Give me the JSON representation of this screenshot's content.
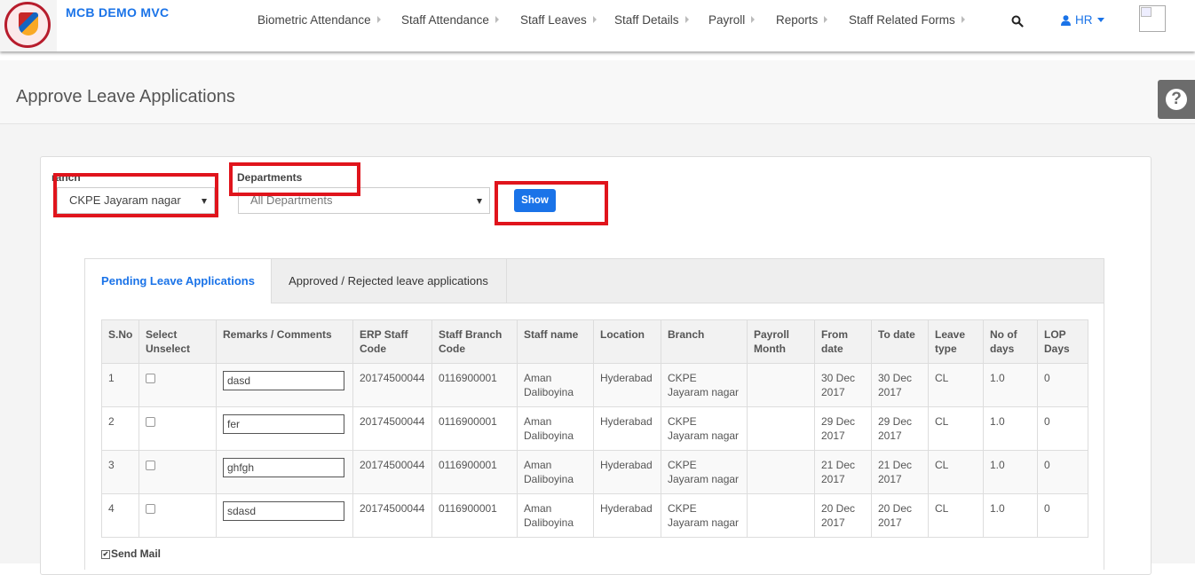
{
  "app": {
    "title": "MCB DEMO MVC"
  },
  "nav": {
    "items": [
      {
        "label": "Biometric Attendance"
      },
      {
        "label": "Staff Attendance"
      },
      {
        "label": "Staff Leaves"
      },
      {
        "label": "Staff Details"
      },
      {
        "label": "Payroll"
      },
      {
        "label": "Reports"
      },
      {
        "label": "Staff Related Forms"
      }
    ],
    "user": "HR"
  },
  "page": {
    "title": "Approve Leave Applications"
  },
  "filters": {
    "branch_label": "ranch",
    "branch_value": "CKPE Jayaram nagar",
    "dept_label": "Departments",
    "dept_value": "All Departments",
    "show_label": "Show"
  },
  "tabs": [
    {
      "label": "Pending Leave Applications",
      "active": true
    },
    {
      "label": "Approved / Rejected leave applications",
      "active": false
    }
  ],
  "table": {
    "headers": [
      "S.No",
      "Select Unselect",
      "Remarks / Comments",
      "ERP Staff Code",
      "Staff Branch Code",
      "Staff name",
      "Location",
      "Branch",
      "Payroll Month",
      "From date",
      "To date",
      "Leave type",
      "No of days",
      "LOP Days"
    ],
    "rows": [
      {
        "sno": "1",
        "remark": "dasd",
        "erp": "20174500044",
        "branch_code": "0116900001",
        "name": "Aman Daliboyina",
        "location": "Hyderabad",
        "branch": "CKPE Jayaram nagar",
        "payroll": "",
        "from": "30 Dec 2017",
        "to": "30 Dec 2017",
        "type": "CL",
        "days": "1.0",
        "lop": "0"
      },
      {
        "sno": "2",
        "remark": "fer",
        "erp": "20174500044",
        "branch_code": "0116900001",
        "name": "Aman Daliboyina",
        "location": "Hyderabad",
        "branch": "CKPE Jayaram nagar",
        "payroll": "",
        "from": "29 Dec 2017",
        "to": "29 Dec 2017",
        "type": "CL",
        "days": "1.0",
        "lop": "0"
      },
      {
        "sno": "3",
        "remark": "ghfgh",
        "erp": "20174500044",
        "branch_code": "0116900001",
        "name": "Aman Daliboyina",
        "location": "Hyderabad",
        "branch": "CKPE Jayaram nagar",
        "payroll": "",
        "from": "21 Dec 2017",
        "to": "21 Dec 2017",
        "type": "CL",
        "days": "1.0",
        "lop": "0"
      },
      {
        "sno": "4",
        "remark": "sdasd",
        "erp": "20174500044",
        "branch_code": "0116900001",
        "name": "Aman Daliboyina",
        "location": "Hyderabad",
        "branch": "CKPE Jayaram nagar",
        "payroll": "",
        "from": "20 Dec 2017",
        "to": "20 Dec 2017",
        "type": "CL",
        "days": "1.0",
        "lop": "0"
      }
    ]
  },
  "send_mail": {
    "label": "Send Mail",
    "checked": true
  },
  "colors": {
    "accent": "#1a73e8",
    "annotation": "#e0141c",
    "help_button": "#6c6c6c"
  },
  "icons": {
    "search": "search-icon",
    "user": "user-icon",
    "help": "help-icon"
  }
}
